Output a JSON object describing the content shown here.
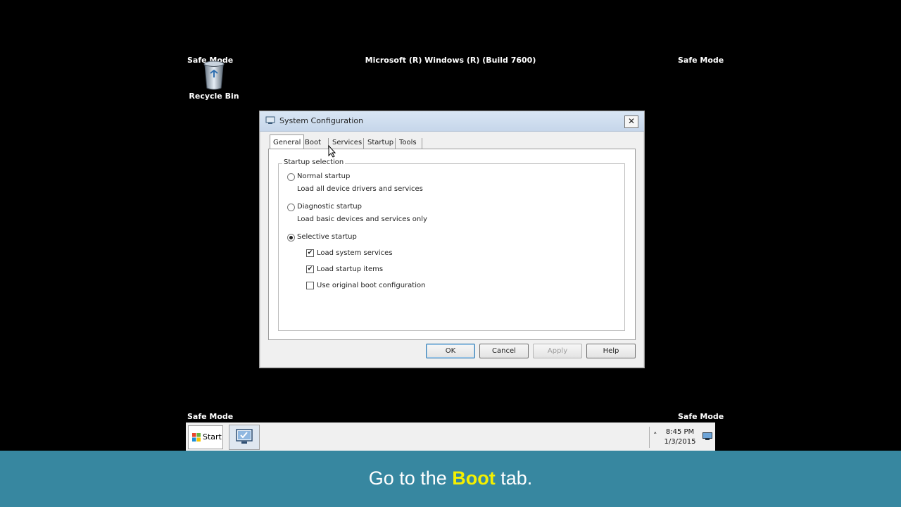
{
  "desktop": {
    "safe_mode_tl": "Safe Mode",
    "safe_mode_tr": "Safe Mode",
    "safe_mode_bl": "Safe Mode",
    "safe_mode_br": "Safe Mode",
    "os_title": "Microsoft (R) Windows (R) (Build 7600)",
    "recycle_bin_label": "Recycle Bin"
  },
  "dialog": {
    "title": "System Configuration",
    "close_label": "✕",
    "tabs": [
      {
        "label": "General",
        "active": true
      },
      {
        "label": "Boot",
        "active": false
      },
      {
        "label": "Services",
        "active": false
      },
      {
        "label": "Startup",
        "active": false
      },
      {
        "label": "Tools",
        "active": false
      }
    ],
    "group_title": "Startup selection",
    "options": {
      "normal": {
        "label": "Normal startup",
        "desc": "Load all device drivers and services",
        "selected": false
      },
      "diagnostic": {
        "label": "Diagnostic startup",
        "desc": "Load basic devices and services only",
        "selected": false
      },
      "selective": {
        "label": "Selective startup",
        "selected": true
      }
    },
    "checkboxes": {
      "system_services": {
        "label": "Load system services",
        "checked": true,
        "mark": "✔"
      },
      "startup_items": {
        "label": "Load startup items",
        "checked": true,
        "mark": "✔"
      },
      "original_boot": {
        "label": "Use original boot configuration",
        "checked": false,
        "mark": ""
      }
    },
    "buttons": {
      "ok": "OK",
      "cancel": "Cancel",
      "apply": "Apply",
      "help": "Help"
    }
  },
  "taskbar": {
    "start_label": "Start",
    "tray_arrow": "˄",
    "time": "8:45 PM",
    "date": "1/3/2015"
  },
  "caption": {
    "prefix": "Go to the ",
    "highlight": "Boot",
    "suffix": " tab."
  },
  "colors": {
    "banner": "#3787a0",
    "highlight": "#f4f000"
  }
}
